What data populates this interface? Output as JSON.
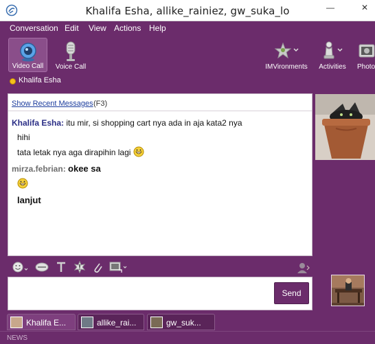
{
  "window": {
    "title": "Khalifa Esha, allike_rainiez, gw_suka_lo",
    "minimize_glyph": "—",
    "close_glyph": "✕"
  },
  "menu": [
    "Conversation",
    "Edit",
    "View",
    "Actions",
    "Help"
  ],
  "toolbar": {
    "video_call": "Video Call",
    "voice_call": "Voice Call",
    "imvironments": "IMVironments",
    "activities": "Activities",
    "photos": "Photo"
  },
  "contact": {
    "name": "Khalifa Esha",
    "status_color": "#f4c21b"
  },
  "chat": {
    "recent_link": "Show Recent Messages",
    "recent_key": "(F3)",
    "messages": [
      {
        "sender": "Khalifa Esha:",
        "text": "itu mir, si shopping cart nya ada in aja kata2 nya"
      },
      {
        "text": "hihi"
      },
      {
        "text": "tata letak nya aga dirapihin lagi"
      },
      {
        "sender": "mirza.febrian:",
        "text": "okee sa"
      },
      {
        "text": "lanjut"
      }
    ]
  },
  "input": {
    "value": "",
    "send_label": "Send"
  },
  "tabs": [
    {
      "label": "Khalifa E..."
    },
    {
      "label": "allike_rai..."
    },
    {
      "label": "gw_suk..."
    }
  ],
  "news": {
    "label": "NEWS"
  },
  "colors": {
    "accent": "#6b2c6b",
    "link": "#1b3c9d",
    "sender1": "#2b2e86",
    "sender2": "#6d6d6d"
  },
  "icons": {
    "video_call": "webcam-icon",
    "voice_call": "microphone-icon",
    "imvironments": "imvironments-icon",
    "activities": "chess-piece-icon",
    "photos": "photos-icon",
    "emoticon": "smiley-icon",
    "buzz": "buzz-icon",
    "text_format": "text-format-icon",
    "attach": "paperclip-icon",
    "share": "share-icon"
  }
}
